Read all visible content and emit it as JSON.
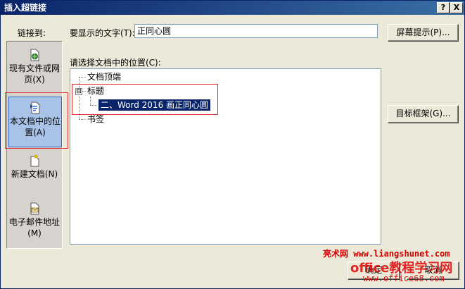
{
  "window": {
    "title": "插入超链接",
    "help_button": "?",
    "close_button": "X"
  },
  "link_to": {
    "label": "链接到:",
    "items": [
      {
        "label": "现有文件或网页(X)",
        "icon": "globe-file-icon",
        "selected": false
      },
      {
        "label": "本文档中的位置(A)",
        "icon": "document-place-icon",
        "selected": true
      },
      {
        "label": "新建文档(N)",
        "icon": "new-document-icon",
        "selected": false
      },
      {
        "label": "电子邮件地址(M)",
        "icon": "email-icon",
        "selected": false
      }
    ]
  },
  "display_text": {
    "label": "要显示的文字(T):",
    "value": "正同心圆"
  },
  "screen_tip_button": "屏幕提示(P)...",
  "location": {
    "label": "请选择文档中的位置(C):",
    "tree": {
      "top_of_document": "文档顶端",
      "headings": {
        "label": "标题",
        "expander": "⊟",
        "children": [
          "二、Word 2016 画正同心圆"
        ]
      },
      "bookmarks": "书签"
    }
  },
  "target_frame_button": "目标框架(G)...",
  "ok_button": "确定",
  "cancel_button": "取消",
  "watermark": {
    "line1": "亮术网 www.liangshunet.com",
    "line2": "office教程学习网",
    "line3": "www.office68.com"
  },
  "colors": {
    "selection": "#0a246a",
    "highlight_box": "#e03030",
    "sidebar_selected": "#a9c3e8"
  }
}
